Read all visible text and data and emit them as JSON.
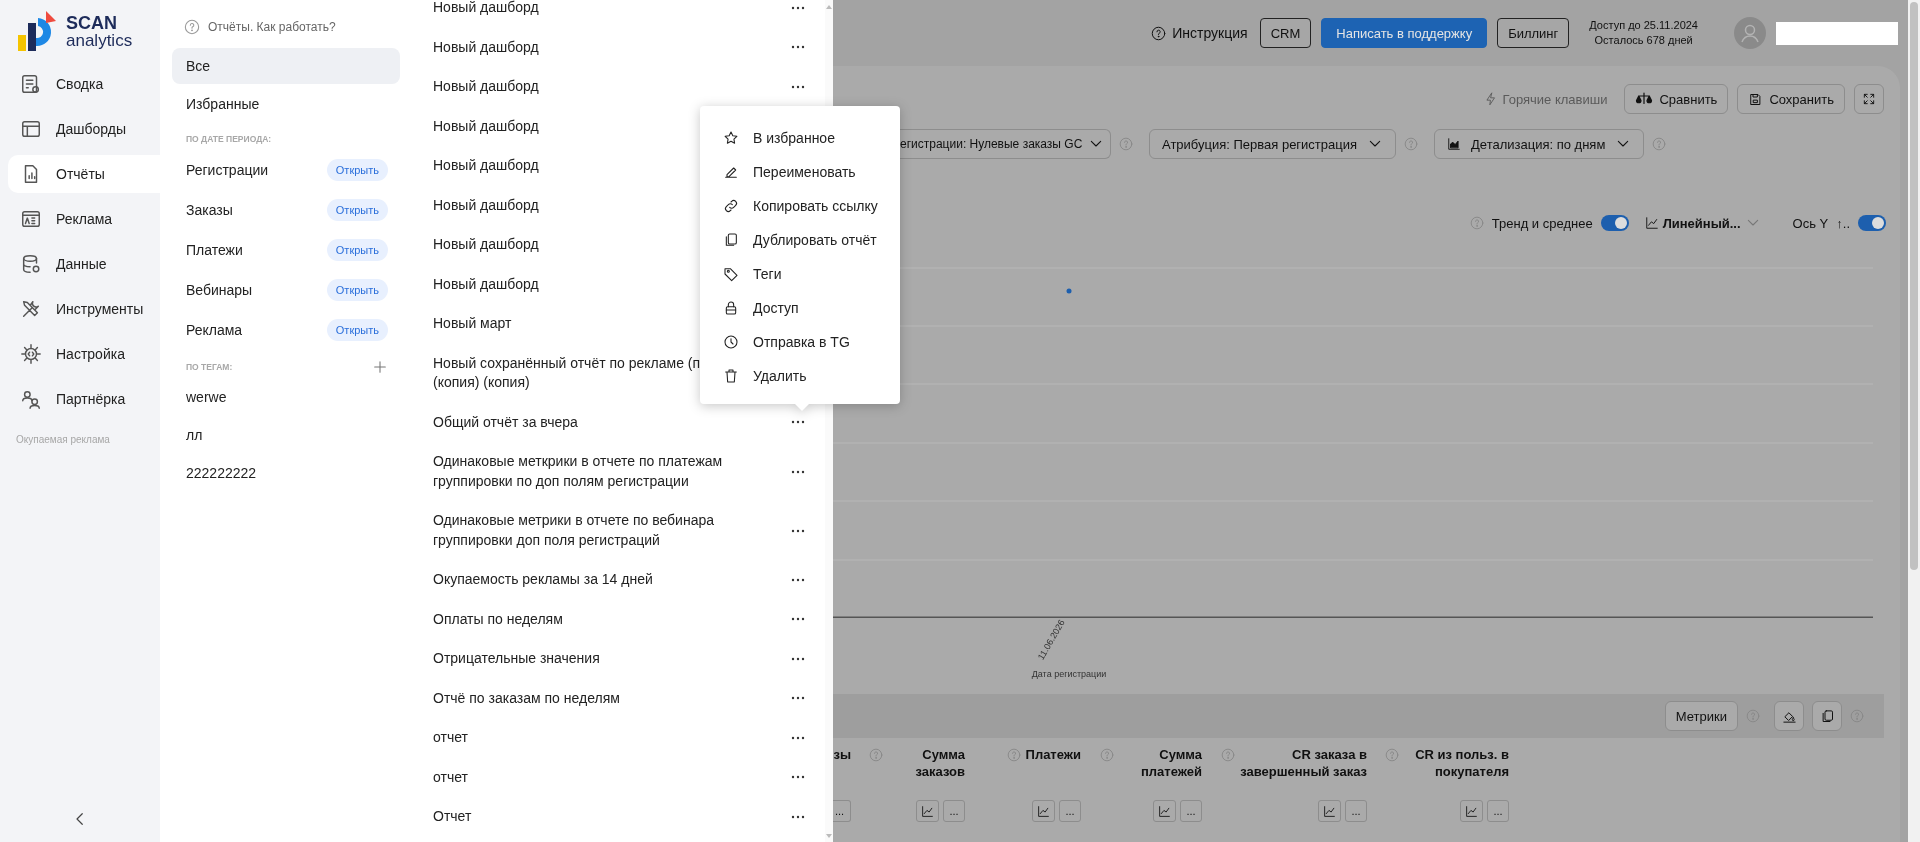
{
  "nav": {
    "logo": {
      "title": "SCAN",
      "subtitle": "analytics"
    },
    "items": [
      {
        "label": "Сводка",
        "selected": false
      },
      {
        "label": "Дашборды",
        "selected": false
      },
      {
        "label": "Отчёты",
        "selected": true
      },
      {
        "label": "Реклама",
        "selected": false
      },
      {
        "label": "Данные",
        "selected": false
      },
      {
        "label": "Инструменты",
        "selected": false
      },
      {
        "label": "Настройка",
        "selected": false
      },
      {
        "label": "Партнёрка",
        "selected": false
      }
    ],
    "note": "Окупаемая реклама"
  },
  "reports_panel": {
    "help": "Отчёты. Как работать?",
    "filters": [
      {
        "label": "Все",
        "selected": true
      },
      {
        "label": "Избранные",
        "selected": false
      }
    ],
    "period_title": "ПО ДАТЕ ПЕРИОДА:",
    "periods": [
      {
        "label": "Регистрации",
        "action": "Открыть"
      },
      {
        "label": "Заказы",
        "action": "Открыть"
      },
      {
        "label": "Платежи",
        "action": "Открыть"
      },
      {
        "label": "Вебинары",
        "action": "Открыть"
      },
      {
        "label": "Реклама",
        "action": "Открыть"
      }
    ],
    "tags_title": "ПО ТЕГАМ:",
    "tags": [
      {
        "label": "werwe",
        "selected": false
      },
      {
        "label": "лл",
        "selected": false
      },
      {
        "label": "222222222",
        "selected": false
      }
    ]
  },
  "reports_list": {
    "items": [
      {
        "title": "Новый дашборд",
        "more_button": true
      },
      {
        "title": "Новый дашборд",
        "more_button": true
      },
      {
        "title": "Новый дашборд",
        "more_button": true
      },
      {
        "title": "Новый дашборд",
        "more_button": false
      },
      {
        "title": "Новый дашборд",
        "more_button": false
      },
      {
        "title": "Новый дашборд",
        "more_button": false
      },
      {
        "title": "Новый дашборд",
        "more_button": false
      },
      {
        "title": "Новый дашборд",
        "more_button": false
      },
      {
        "title": "Новый март",
        "more_button": false
      },
      {
        "title": "Новый сохранённый отчёт по рекламе (п\n(копия) (копия)",
        "more_button": false
      },
      {
        "title": "Общий отчёт за вчера",
        "more_button": true
      },
      {
        "title": "Одинаковые меткрики в отчете по платежам группировки по доп полям регистрации",
        "more_button": true
      },
      {
        "title": "Одинаковые метрики в отчете по вебинара группировки доп поля регистраций",
        "more_button": true
      },
      {
        "title": "Окупаемость рекламы за 14 дней",
        "more_button": true
      },
      {
        "title": "Оплаты по неделям",
        "more_button": true
      },
      {
        "title": "Отрицательные значения",
        "more_button": true
      },
      {
        "title": "Отчё по заказам по неделям",
        "more_button": true
      },
      {
        "title": "отчет",
        "more_button": true
      },
      {
        "title": "отчет",
        "more_button": true
      },
      {
        "title": "Отчет",
        "more_button": true
      }
    ]
  },
  "context_menu": {
    "items": [
      {
        "label": "В избранное"
      },
      {
        "label": "Переименовать"
      },
      {
        "label": "Копировать ссылку"
      },
      {
        "label": "Дублировать отчёт"
      },
      {
        "label": "Теги"
      },
      {
        "label": "Доступ"
      },
      {
        "label": "Отправка в TG"
      },
      {
        "label": "Удалить"
      }
    ]
  },
  "header": {
    "help": "Инструкция",
    "buttons": [
      {
        "label": "CRM",
        "kind": "outline"
      },
      {
        "label": "Написать в поддержку",
        "kind": "primary"
      },
      {
        "label": "Биллинг",
        "kind": "outline"
      }
    ],
    "access": "Доступ до 25.11.2024",
    "days_left": "Осталось 678 дней"
  },
  "toolbar": {
    "hotkeys": "Горячие клавиши",
    "compare": "Сравнить",
    "save": "Сохранить"
  },
  "filters": [
    {
      "label": "егистрации: Нулевые заказы GC"
    },
    {
      "label": "Атрибуция: Первая регистрация"
    },
    {
      "label": "Детализация: по дням"
    }
  ],
  "chart_options": {
    "trend": {
      "label": "Тренд и среднее",
      "on": true
    },
    "type": "Линейный...",
    "axis": {
      "label": "Ось Y",
      "extra": "↑..",
      "on": true
    }
  },
  "chart": {
    "tick": "11.06.2026",
    "axis_title": "Дата регистрации"
  },
  "table": {
    "metrics_button": "Метрики",
    "columns": [
      {
        "title": "зы",
        "help": true,
        "chart_button": false,
        "more": "..."
      },
      {
        "title": "Сумма заказов",
        "help": true,
        "chart_button": true,
        "more": "..."
      },
      {
        "title": "Платежи",
        "help": true,
        "chart_button": true,
        "more": "..."
      },
      {
        "title": "Сумма платежей",
        "help": true,
        "chart_button": true,
        "more": "..."
      },
      {
        "title": "CR заказа в завершенный заказ",
        "help": true,
        "chart_button": true,
        "more": "..."
      },
      {
        "title": "CR из польз. в покупателя",
        "help": false,
        "chart_button": true,
        "more": "..."
      }
    ]
  }
}
